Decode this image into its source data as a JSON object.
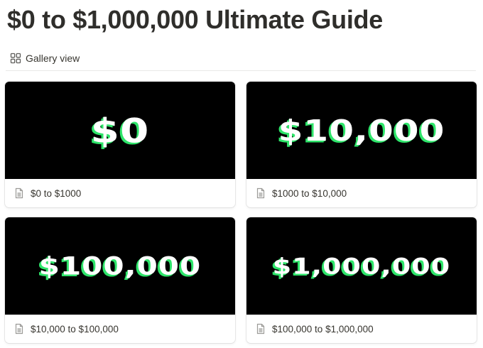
{
  "page": {
    "title": "$0 to $1,000,000 Ultimate Guide"
  },
  "view": {
    "label": "Gallery view",
    "icon": "gallery-grid-icon"
  },
  "colors": {
    "cover_bg": "#000000",
    "cover_text": "#ffffff",
    "cover_shadow": "#2ee56a"
  },
  "cards": [
    {
      "cover": "$0",
      "title": "$0 to $1000"
    },
    {
      "cover": "$10,000",
      "title": "$1000 to $10,000"
    },
    {
      "cover": "$100,000",
      "title": "$10,000 to $100,000"
    },
    {
      "cover": "$1,000,000",
      "title": "$100,000 to $1,000,000"
    }
  ]
}
